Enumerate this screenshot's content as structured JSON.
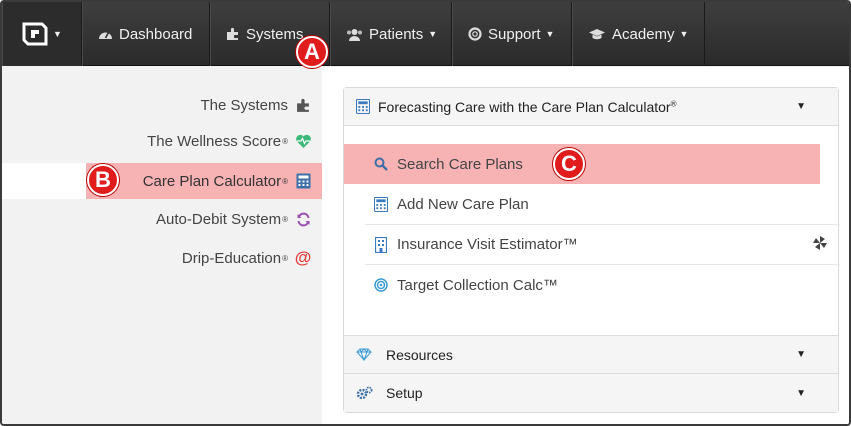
{
  "navbar": {
    "items": [
      {
        "label": "Dashboard",
        "icon": "dashboard-icon",
        "caret": false
      },
      {
        "label": "Systems",
        "icon": "puzzle-icon",
        "caret": false
      },
      {
        "label": "Patients",
        "icon": "users-icon",
        "caret": true
      },
      {
        "label": "Support",
        "icon": "lifebuoy-icon",
        "caret": true
      },
      {
        "label": "Academy",
        "icon": "graduation-cap-icon",
        "caret": true
      }
    ]
  },
  "sidebar": {
    "items": [
      {
        "label": "The Systems",
        "reg": "",
        "icon": "puzzle-icon"
      },
      {
        "label": "The Wellness Score",
        "reg": "®",
        "icon": "heartbeat-icon"
      },
      {
        "label": "Care Plan Calculator",
        "reg": "®",
        "icon": "calculator-icon"
      },
      {
        "label": "Auto-Debit System",
        "reg": "®",
        "icon": "refresh-icon"
      },
      {
        "label": "Drip-Education",
        "reg": "®",
        "icon": "at-icon"
      }
    ]
  },
  "panel": {
    "title": "Forecasting Care with the Care Plan Calculator",
    "reg": "®",
    "items": [
      {
        "label": "Search Care Plans",
        "icon": "search-icon"
      },
      {
        "label": "Add New Care Plan",
        "icon": "calculator-icon"
      },
      {
        "label": "Insurance Visit Estimator™",
        "icon": "building-icon"
      },
      {
        "label": "Target Collection Calc™",
        "icon": "target-icon"
      }
    ],
    "sections": [
      {
        "label": "Resources",
        "icon": "diamond-icon"
      },
      {
        "label": "Setup",
        "icon": "cogs-icon"
      }
    ]
  },
  "callouts": {
    "a": "A",
    "b": "B",
    "c": "C"
  },
  "colors": {
    "highlight": "#f7b3b3",
    "callout": "#e01c1c",
    "navbar": "#333333",
    "icon_blue": "#3a7bbf"
  }
}
